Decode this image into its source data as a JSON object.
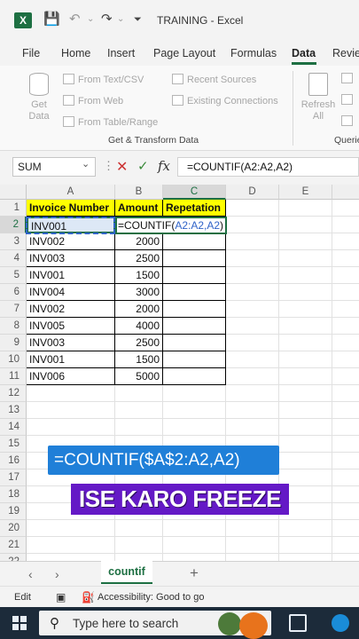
{
  "title_bar": {
    "logo_letter": "X",
    "doc_title": "TRAINING  -  Excel"
  },
  "menu": {
    "tabs": [
      "File",
      "Home",
      "Insert",
      "Page Layout",
      "Formulas",
      "Data",
      "Revie"
    ],
    "active": "Data"
  },
  "ribbon": {
    "get_data": "Get Data",
    "from_text_csv": "From Text/CSV",
    "from_web": "From Web",
    "from_table_range": "From Table/Range",
    "recent_sources": "Recent Sources",
    "existing_connections": "Existing Connections",
    "refresh_all": "Refresh All",
    "group_get_transform": "Get & Transform Data",
    "group_queries": "Querie"
  },
  "formula_bar": {
    "name_box": "SUM",
    "formula": "=COUNTIF(A2:A2,A2)"
  },
  "grid": {
    "columns": [
      "A",
      "B",
      "C",
      "D",
      "E"
    ],
    "selected_column": "C",
    "row_numbers": [
      "1",
      "2",
      "3",
      "4",
      "5",
      "6",
      "7",
      "8",
      "9",
      "10",
      "11",
      "12",
      "13",
      "14",
      "15",
      "16",
      "17",
      "18",
      "19",
      "20",
      "21",
      "22"
    ],
    "selected_row": "2",
    "headers": [
      "Invoice Number",
      "Amount",
      "Repetation"
    ],
    "rows": [
      [
        "INV001",
        "",
        ""
      ],
      [
        "INV002",
        "2000",
        ""
      ],
      [
        "INV003",
        "2500",
        ""
      ],
      [
        "INV001",
        "1500",
        ""
      ],
      [
        "INV004",
        "3000",
        ""
      ],
      [
        "INV002",
        "2000",
        ""
      ],
      [
        "INV005",
        "4000",
        ""
      ],
      [
        "INV003",
        "2500",
        ""
      ],
      [
        "INV001",
        "1500",
        ""
      ],
      [
        "INV006",
        "5000",
        ""
      ]
    ],
    "editing_cell": {
      "prefix": "=COUNTIF(",
      "ref": "A2:A2,A2",
      "suffix": ")"
    }
  },
  "overlays": {
    "formula_hint": "=COUNTIF($A$2:A2,A2)",
    "caption": "ISE KARO FREEZE"
  },
  "sheets": {
    "active": "countif",
    "add": "+"
  },
  "status": {
    "mode": "Edit",
    "accessibility": "Accessibility: Good to go"
  },
  "taskbar": {
    "search_placeholder": "Type here to search"
  },
  "colors": {
    "excel_green": "#1d6f42",
    "header_yellow": "#ffff00",
    "ref_blue": "#2f63c8",
    "overlay_blue": "#1f7fd8",
    "overlay_purple": "#6419c6"
  }
}
